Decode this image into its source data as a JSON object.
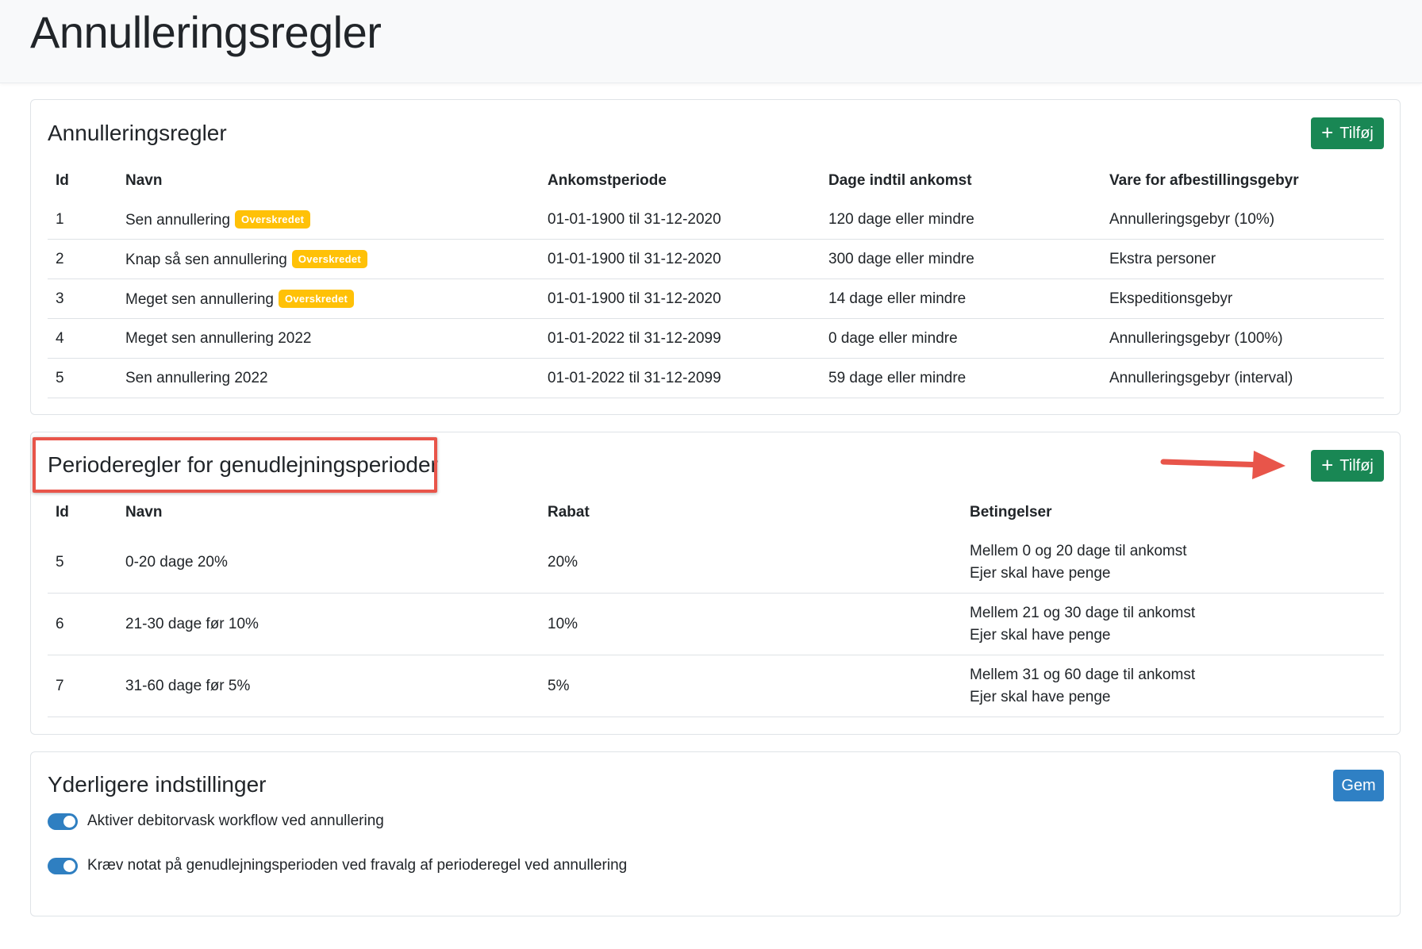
{
  "page": {
    "title": "Annulleringsregler"
  },
  "cancel_rules": {
    "title": "Annulleringsregler",
    "add_label": "Tilføj",
    "badge_label": "Overskredet",
    "columns": [
      "Id",
      "Navn",
      "Ankomstperiode",
      "Dage indtil ankomst",
      "Vare for afbestillingsgebyr"
    ],
    "rows": [
      {
        "id": "1",
        "name": "Sen annullering",
        "overdue": true,
        "period": "01-01-1900 til 31-12-2020",
        "days": "120 dage eller mindre",
        "item": "Annulleringsgebyr (10%)"
      },
      {
        "id": "2",
        "name": "Knap så sen annullering",
        "overdue": true,
        "period": "01-01-1900 til 31-12-2020",
        "days": "300 dage eller mindre",
        "item": "Ekstra personer"
      },
      {
        "id": "3",
        "name": "Meget sen annullering",
        "overdue": true,
        "period": "01-01-1900 til 31-12-2020",
        "days": "14 dage eller mindre",
        "item": "Ekspeditionsgebyr"
      },
      {
        "id": "4",
        "name": "Meget sen annullering 2022",
        "overdue": false,
        "period": "01-01-2022 til 31-12-2099",
        "days": "0 dage eller mindre",
        "item": "Annulleringsgebyr (100%)"
      },
      {
        "id": "5",
        "name": "Sen annullering 2022",
        "overdue": false,
        "period": "01-01-2022 til 31-12-2099",
        "days": "59 dage eller mindre",
        "item": "Annulleringsgebyr (interval)"
      }
    ]
  },
  "period_rules": {
    "title": "Perioderegler for genudlejningsperioder",
    "add_label": "Tilføj",
    "columns": [
      "Id",
      "Navn",
      "Rabat",
      "Betingelser"
    ],
    "rows": [
      {
        "id": "5",
        "name": "0-20 dage 20%",
        "discount": "20%",
        "cond1": "Mellem 0 og 20 dage til ankomst",
        "cond2": "Ejer skal have penge"
      },
      {
        "id": "6",
        "name": "21-30 dage før 10%",
        "discount": "10%",
        "cond1": "Mellem 21 og 30 dage til ankomst",
        "cond2": "Ejer skal have penge"
      },
      {
        "id": "7",
        "name": "31-60 dage før 5%",
        "discount": "5%",
        "cond1": "Mellem 31 og 60 dage til ankomst",
        "cond2": "Ejer skal have penge"
      }
    ]
  },
  "settings": {
    "title": "Yderligere indstillinger",
    "save_label": "Gem",
    "toggles": [
      {
        "label": "Aktiver debitorvask workflow ved annullering",
        "on": true
      },
      {
        "label": "Kræv notat på genudlejningsperioden ved fravalg af perioderegel ved annullering",
        "on": true
      }
    ]
  },
  "colors": {
    "accent_green": "#198754",
    "accent_blue": "#2f80c4",
    "badge": "#ffc107",
    "annotation": "#e8554a"
  }
}
